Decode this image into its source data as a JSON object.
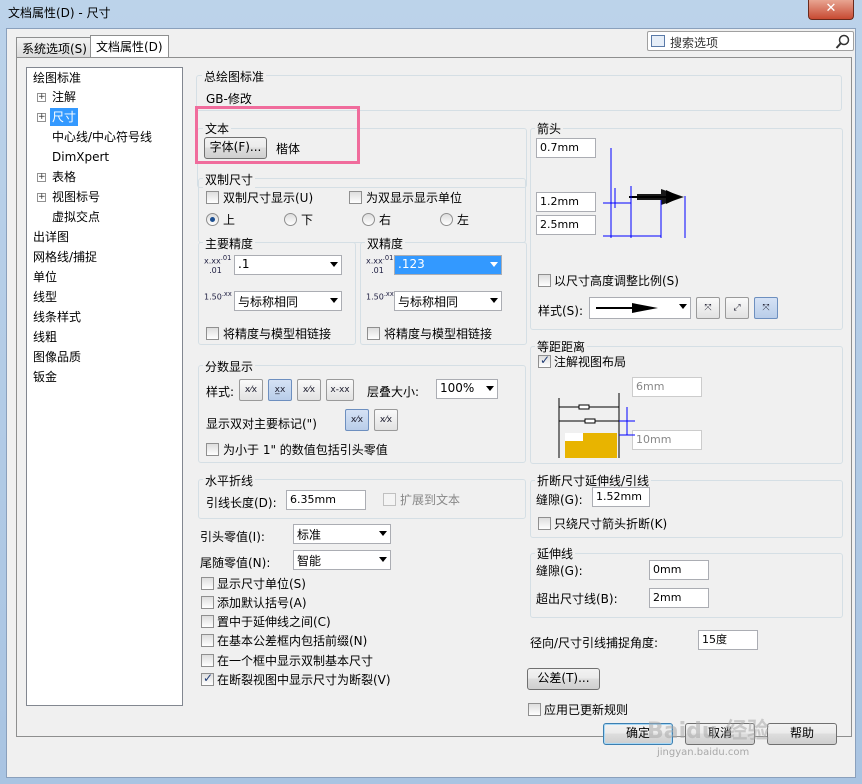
{
  "window": {
    "title": "文档属性(D) - 尺寸",
    "close": "✕"
  },
  "tabs": [
    "系统选项(S)",
    "文档属性(D)"
  ],
  "search": {
    "placeholder": "搜索选项"
  },
  "tree": {
    "items": [
      "绘图标准",
      "注解",
      "尺寸",
      "中心线/中心符号线",
      "DimXpert",
      "表格",
      "视图标号",
      "虚拟交点",
      "出详图",
      "网格线/捕捉",
      "单位",
      "线型",
      "线条样式",
      "线粗",
      "图像品质",
      "钣金"
    ]
  },
  "overall": {
    "label": "总绘图标准",
    "value": "GB-修改"
  },
  "text": {
    "label": "文本",
    "font_button": "字体(F)...",
    "font_name": "楷体"
  },
  "dual": {
    "label": "双制尺寸",
    "show_dual": "双制尺寸显示(U)",
    "show_units": "为双显示显示单位",
    "top": "上",
    "bottom": "下",
    "right": "右",
    "left": "左"
  },
  "primary": {
    "label": "主要精度",
    "value1": ".1",
    "value2": "与标称相同",
    "link": "将精度与模型相链接"
  },
  "dual_precision": {
    "label": "双精度",
    "value1": ".123",
    "value2": "与标称相同",
    "link": "将精度与模型相链接"
  },
  "fraction": {
    "label": "分数显示",
    "style": "样式:",
    "stack_size": "层叠大小:",
    "stack_value": "100%",
    "dual_marks": "显示双对主要标记(\")",
    "include_zeros": "为小于 1\" 的数值包括引头零值"
  },
  "horiz": {
    "label": "水平折线",
    "leader_length": "引线长度(D):",
    "leader_value": "6.35mm",
    "extend": "扩展到文本"
  },
  "leading_zero": {
    "label": "引头零值(I):",
    "value": "标准"
  },
  "trailing_zero": {
    "label": "尾随零值(N):",
    "value": "智能"
  },
  "options": [
    "显示尺寸单位(S)",
    "添加默认括号(A)",
    "置中于延伸线之间(C)",
    "在基本公差框内包括前缀(N)",
    "在一个框中显示双制基本尺寸",
    "在断裂视图中显示尺寸为断裂(V)"
  ],
  "arrows": {
    "label": "箭头",
    "v1": "0.7mm",
    "v2": "1.2mm",
    "v3": "2.5mm",
    "scale": "以尺寸高度调整比例(S)",
    "style": "样式(S):"
  },
  "offset": {
    "label": "等距距离",
    "layout": "注解视图布局",
    "v1": "6mm",
    "v2": "10mm"
  },
  "break": {
    "label": "折断尺寸延伸线/引线",
    "gap_label": "缝隙(G):",
    "gap_value": "1.52mm",
    "only_arrow": "只绕尺寸箭头折断(K)"
  },
  "ext": {
    "label": "延伸线",
    "gap_label": "缝隙(G):",
    "gap_value": "0mm",
    "beyond_label": "超出尺寸线(B):",
    "beyond_value": "2mm"
  },
  "radial": {
    "label": "径向/尺寸引线捕捉角度:",
    "value": "15度"
  },
  "tolerance_button": "公差(T)...",
  "apply_rules": "应用已更新规则",
  "footer": {
    "ok": "确定",
    "cancel": "取消",
    "help": "帮助"
  },
  "watermark": {
    "brand": "Baidu 经验",
    "url": "jingyan.baidu.com"
  },
  "colors": {
    "highlight_box": "#f06c9c",
    "selection": "#3399ff"
  }
}
